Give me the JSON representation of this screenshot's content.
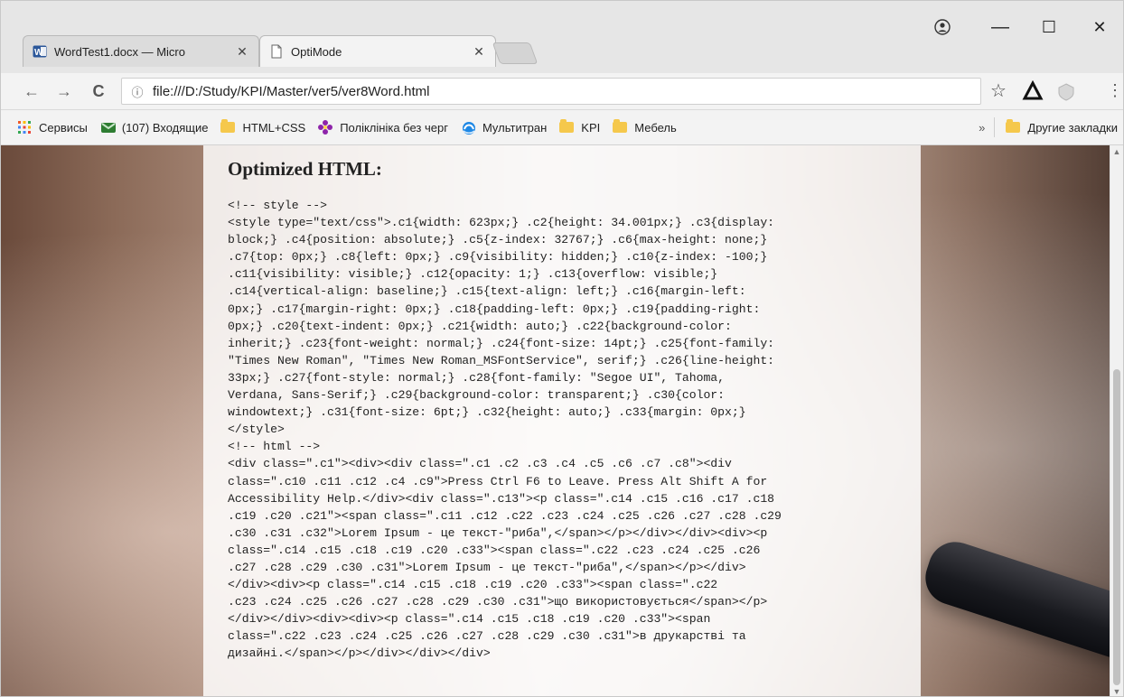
{
  "tabs": [
    {
      "title": "WordTest1.docx — Micro",
      "icon": "word-doc-icon"
    },
    {
      "title": "OptiMode",
      "icon": "page-icon"
    }
  ],
  "window_controls": {
    "profile_icon": "profile-icon",
    "minimize": "—",
    "maximize": "☐",
    "close": "✕"
  },
  "toolbar": {
    "back_icon": "←",
    "forward_icon": "→",
    "reload_icon": "C",
    "info_icon": "ⓘ",
    "url": "file:///D:/Study/KPI/Master/ver5/ver8Word.html",
    "star_icon": "☆",
    "menu_icon": "⋮"
  },
  "bookmarks": {
    "items": [
      {
        "label": "Сервисы",
        "icon": "apps-grid-icon"
      },
      {
        "label": "(107) Входящие",
        "icon": "mail-icon"
      },
      {
        "label": "HTML+CSS",
        "icon": "folder-icon"
      },
      {
        "label": "Поліклініка без черг",
        "icon": "flower-icon"
      },
      {
        "label": "Мультитран",
        "icon": "ie-icon"
      },
      {
        "label": "KPI",
        "icon": "folder-icon"
      },
      {
        "label": "Мебель",
        "icon": "folder-icon"
      }
    ],
    "overflow": "»",
    "other_bookmarks": "Другие закладки"
  },
  "page": {
    "heading": "Optimized HTML:",
    "code": "<!-- style -->\n<style type=\"text/css\">.c1{width: 623px;} .c2{height: 34.001px;} .c3{display:\nblock;} .c4{position: absolute;} .c5{z-index: 32767;} .c6{max-height: none;}\n.c7{top: 0px;} .c8{left: 0px;} .c9{visibility: hidden;} .c10{z-index: -100;}\n.c11{visibility: visible;} .c12{opacity: 1;} .c13{overflow: visible;}\n.c14{vertical-align: baseline;} .c15{text-align: left;} .c16{margin-left:\n0px;} .c17{margin-right: 0px;} .c18{padding-left: 0px;} .c19{padding-right:\n0px;} .c20{text-indent: 0px;} .c21{width: auto;} .c22{background-color:\ninherit;} .c23{font-weight: normal;} .c24{font-size: 14pt;} .c25{font-family:\n\"Times New Roman\", \"Times New Roman_MSFontService\", serif;} .c26{line-height:\n33px;} .c27{font-style: normal;} .c28{font-family: \"Segoe UI\", Tahoma,\nVerdana, Sans-Serif;} .c29{background-color: transparent;} .c30{color:\nwindowtext;} .c31{font-size: 6pt;} .c32{height: auto;} .c33{margin: 0px;}\n</style>\n<!-- html -->\n<div class=\".c1\"><div><div class=\".c1 .c2 .c3 .c4 .c5 .c6 .c7 .c8\"><div\nclass=\".c10 .c11 .c12 .c4 .c9\">Press Ctrl F6 to Leave. Press Alt Shift A for\nAccessibility Help.</div><div class=\".c13\"><p class=\".c14 .c15 .c16 .c17 .c18\n.c19 .c20 .c21\"><span class=\".c11 .c12 .c22 .c23 .c24 .c25 .c26 .c27 .c28 .c29\n.c30 .c31 .c32\">Lorem Ipsum - це текст-\"риба\",</span></p></div></div><div><p\nclass=\".c14 .c15 .c18 .c19 .c20 .c33\"><span class=\".c22 .c23 .c24 .c25 .c26\n.c27 .c28 .c29 .c30 .c31\">Lorem Ipsum - це текст-\"риба\",</span></p></div>\n</div><div><p class=\".c14 .c15 .c18 .c19 .c20 .c33\"><span class=\".c22\n.c23 .c24 .c25 .c26 .c27 .c28 .c29 .c30 .c31\">що використовується</span></p>\n</div></div><div><div><p class=\".c14 .c15 .c18 .c19 .c20 .c33\"><span\nclass=\".c22 .c23 .c24 .c25 .c26 .c27 .c28 .c29 .c30 .c31\">в друкарстві та\nдизайні.</span></p></div></div></div>"
  },
  "colors": {
    "chrome_bg": "#e6e6e6",
    "toolbar_bg": "#f3f3f3",
    "panel_bg": "#ffffff",
    "text": "#222222"
  }
}
